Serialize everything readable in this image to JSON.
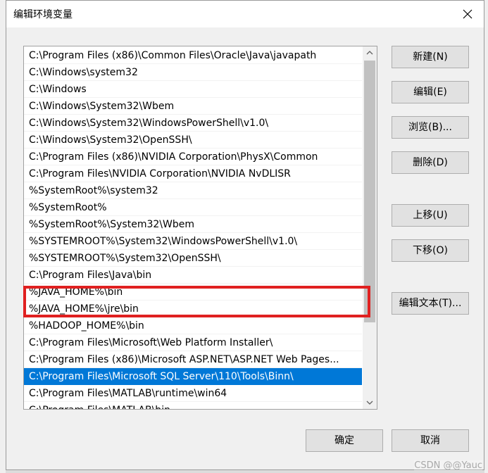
{
  "title": "编辑环境变量",
  "path_entries": [
    "C:\\Program Files (x86)\\Common Files\\Oracle\\Java\\javapath",
    "C:\\Windows\\system32",
    "C:\\Windows",
    "C:\\Windows\\System32\\Wbem",
    "C:\\Windows\\System32\\WindowsPowerShell\\v1.0\\",
    "C:\\Windows\\System32\\OpenSSH\\",
    "C:\\Program Files (x86)\\NVIDIA Corporation\\PhysX\\Common",
    "C:\\Program Files\\NVIDIA Corporation\\NVIDIA NvDLISR",
    "%SystemRoot%\\system32",
    "%SystemRoot%",
    "%SystemRoot%\\System32\\Wbem",
    "%SYSTEMROOT%\\System32\\WindowsPowerShell\\v1.0\\",
    "%SYSTEMROOT%\\System32\\OpenSSH\\",
    "C:\\Program Files\\Java\\bin",
    "%JAVA_HOME%\\bin",
    "%JAVA_HOME%\\jre\\bin",
    "%HADOOP_HOME%\\bin",
    "C:\\Program Files\\Microsoft\\Web Platform Installer\\",
    "C:\\Program Files (x86)\\Microsoft ASP.NET\\ASP.NET Web Pages...",
    "C:\\Program Files\\Microsoft SQL Server\\110\\Tools\\Binn\\",
    "C:\\Program Files\\MATLAB\\runtime\\win64",
    "C:\\Program Files\\MATLAB\\bin"
  ],
  "selected_index": 19,
  "buttons": {
    "new": "新建(N)",
    "edit": "编辑(E)",
    "browse": "浏览(B)...",
    "delete": "删除(D)",
    "move_up": "上移(U)",
    "move_down": "下移(O)",
    "edit_text": "编辑文本(T)...",
    "ok": "确定",
    "cancel": "取消"
  },
  "watermark": "CSDN @@Yauc",
  "colors": {
    "selection": "#0078d7",
    "annotation": "#e02020"
  }
}
